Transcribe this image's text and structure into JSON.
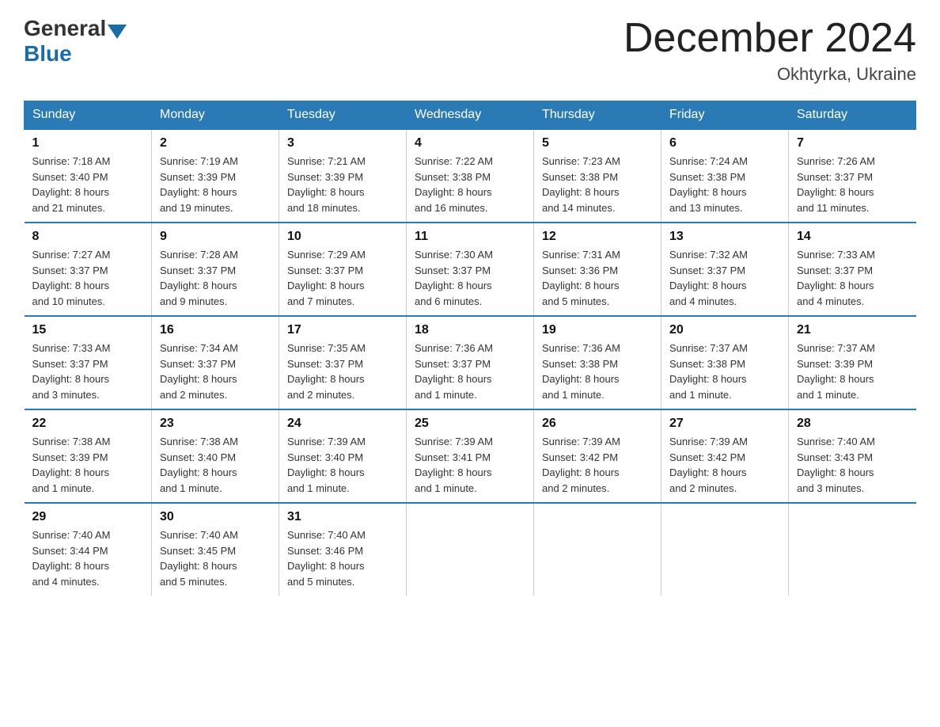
{
  "logo": {
    "general": "General",
    "blue": "Blue"
  },
  "title": "December 2024",
  "location": "Okhtyrka, Ukraine",
  "days_of_week": [
    "Sunday",
    "Monday",
    "Tuesday",
    "Wednesday",
    "Thursday",
    "Friday",
    "Saturday"
  ],
  "weeks": [
    [
      {
        "day": "1",
        "sunrise": "7:18 AM",
        "sunset": "3:40 PM",
        "daylight": "8 hours and 21 minutes."
      },
      {
        "day": "2",
        "sunrise": "7:19 AM",
        "sunset": "3:39 PM",
        "daylight": "8 hours and 19 minutes."
      },
      {
        "day": "3",
        "sunrise": "7:21 AM",
        "sunset": "3:39 PM",
        "daylight": "8 hours and 18 minutes."
      },
      {
        "day": "4",
        "sunrise": "7:22 AM",
        "sunset": "3:38 PM",
        "daylight": "8 hours and 16 minutes."
      },
      {
        "day": "5",
        "sunrise": "7:23 AM",
        "sunset": "3:38 PM",
        "daylight": "8 hours and 14 minutes."
      },
      {
        "day": "6",
        "sunrise": "7:24 AM",
        "sunset": "3:38 PM",
        "daylight": "8 hours and 13 minutes."
      },
      {
        "day": "7",
        "sunrise": "7:26 AM",
        "sunset": "3:37 PM",
        "daylight": "8 hours and 11 minutes."
      }
    ],
    [
      {
        "day": "8",
        "sunrise": "7:27 AM",
        "sunset": "3:37 PM",
        "daylight": "8 hours and 10 minutes."
      },
      {
        "day": "9",
        "sunrise": "7:28 AM",
        "sunset": "3:37 PM",
        "daylight": "8 hours and 9 minutes."
      },
      {
        "day": "10",
        "sunrise": "7:29 AM",
        "sunset": "3:37 PM",
        "daylight": "8 hours and 7 minutes."
      },
      {
        "day": "11",
        "sunrise": "7:30 AM",
        "sunset": "3:37 PM",
        "daylight": "8 hours and 6 minutes."
      },
      {
        "day": "12",
        "sunrise": "7:31 AM",
        "sunset": "3:36 PM",
        "daylight": "8 hours and 5 minutes."
      },
      {
        "day": "13",
        "sunrise": "7:32 AM",
        "sunset": "3:37 PM",
        "daylight": "8 hours and 4 minutes."
      },
      {
        "day": "14",
        "sunrise": "7:33 AM",
        "sunset": "3:37 PM",
        "daylight": "8 hours and 4 minutes."
      }
    ],
    [
      {
        "day": "15",
        "sunrise": "7:33 AM",
        "sunset": "3:37 PM",
        "daylight": "8 hours and 3 minutes."
      },
      {
        "day": "16",
        "sunrise": "7:34 AM",
        "sunset": "3:37 PM",
        "daylight": "8 hours and 2 minutes."
      },
      {
        "day": "17",
        "sunrise": "7:35 AM",
        "sunset": "3:37 PM",
        "daylight": "8 hours and 2 minutes."
      },
      {
        "day": "18",
        "sunrise": "7:36 AM",
        "sunset": "3:37 PM",
        "daylight": "8 hours and 1 minute."
      },
      {
        "day": "19",
        "sunrise": "7:36 AM",
        "sunset": "3:38 PM",
        "daylight": "8 hours and 1 minute."
      },
      {
        "day": "20",
        "sunrise": "7:37 AM",
        "sunset": "3:38 PM",
        "daylight": "8 hours and 1 minute."
      },
      {
        "day": "21",
        "sunrise": "7:37 AM",
        "sunset": "3:39 PM",
        "daylight": "8 hours and 1 minute."
      }
    ],
    [
      {
        "day": "22",
        "sunrise": "7:38 AM",
        "sunset": "3:39 PM",
        "daylight": "8 hours and 1 minute."
      },
      {
        "day": "23",
        "sunrise": "7:38 AM",
        "sunset": "3:40 PM",
        "daylight": "8 hours and 1 minute."
      },
      {
        "day": "24",
        "sunrise": "7:39 AM",
        "sunset": "3:40 PM",
        "daylight": "8 hours and 1 minute."
      },
      {
        "day": "25",
        "sunrise": "7:39 AM",
        "sunset": "3:41 PM",
        "daylight": "8 hours and 1 minute."
      },
      {
        "day": "26",
        "sunrise": "7:39 AM",
        "sunset": "3:42 PM",
        "daylight": "8 hours and 2 minutes."
      },
      {
        "day": "27",
        "sunrise": "7:39 AM",
        "sunset": "3:42 PM",
        "daylight": "8 hours and 2 minutes."
      },
      {
        "day": "28",
        "sunrise": "7:40 AM",
        "sunset": "3:43 PM",
        "daylight": "8 hours and 3 minutes."
      }
    ],
    [
      {
        "day": "29",
        "sunrise": "7:40 AM",
        "sunset": "3:44 PM",
        "daylight": "8 hours and 4 minutes."
      },
      {
        "day": "30",
        "sunrise": "7:40 AM",
        "sunset": "3:45 PM",
        "daylight": "8 hours and 5 minutes."
      },
      {
        "day": "31",
        "sunrise": "7:40 AM",
        "sunset": "3:46 PM",
        "daylight": "8 hours and 5 minutes."
      },
      null,
      null,
      null,
      null
    ]
  ],
  "labels": {
    "sunrise": "Sunrise:",
    "sunset": "Sunset:",
    "daylight": "Daylight:"
  }
}
